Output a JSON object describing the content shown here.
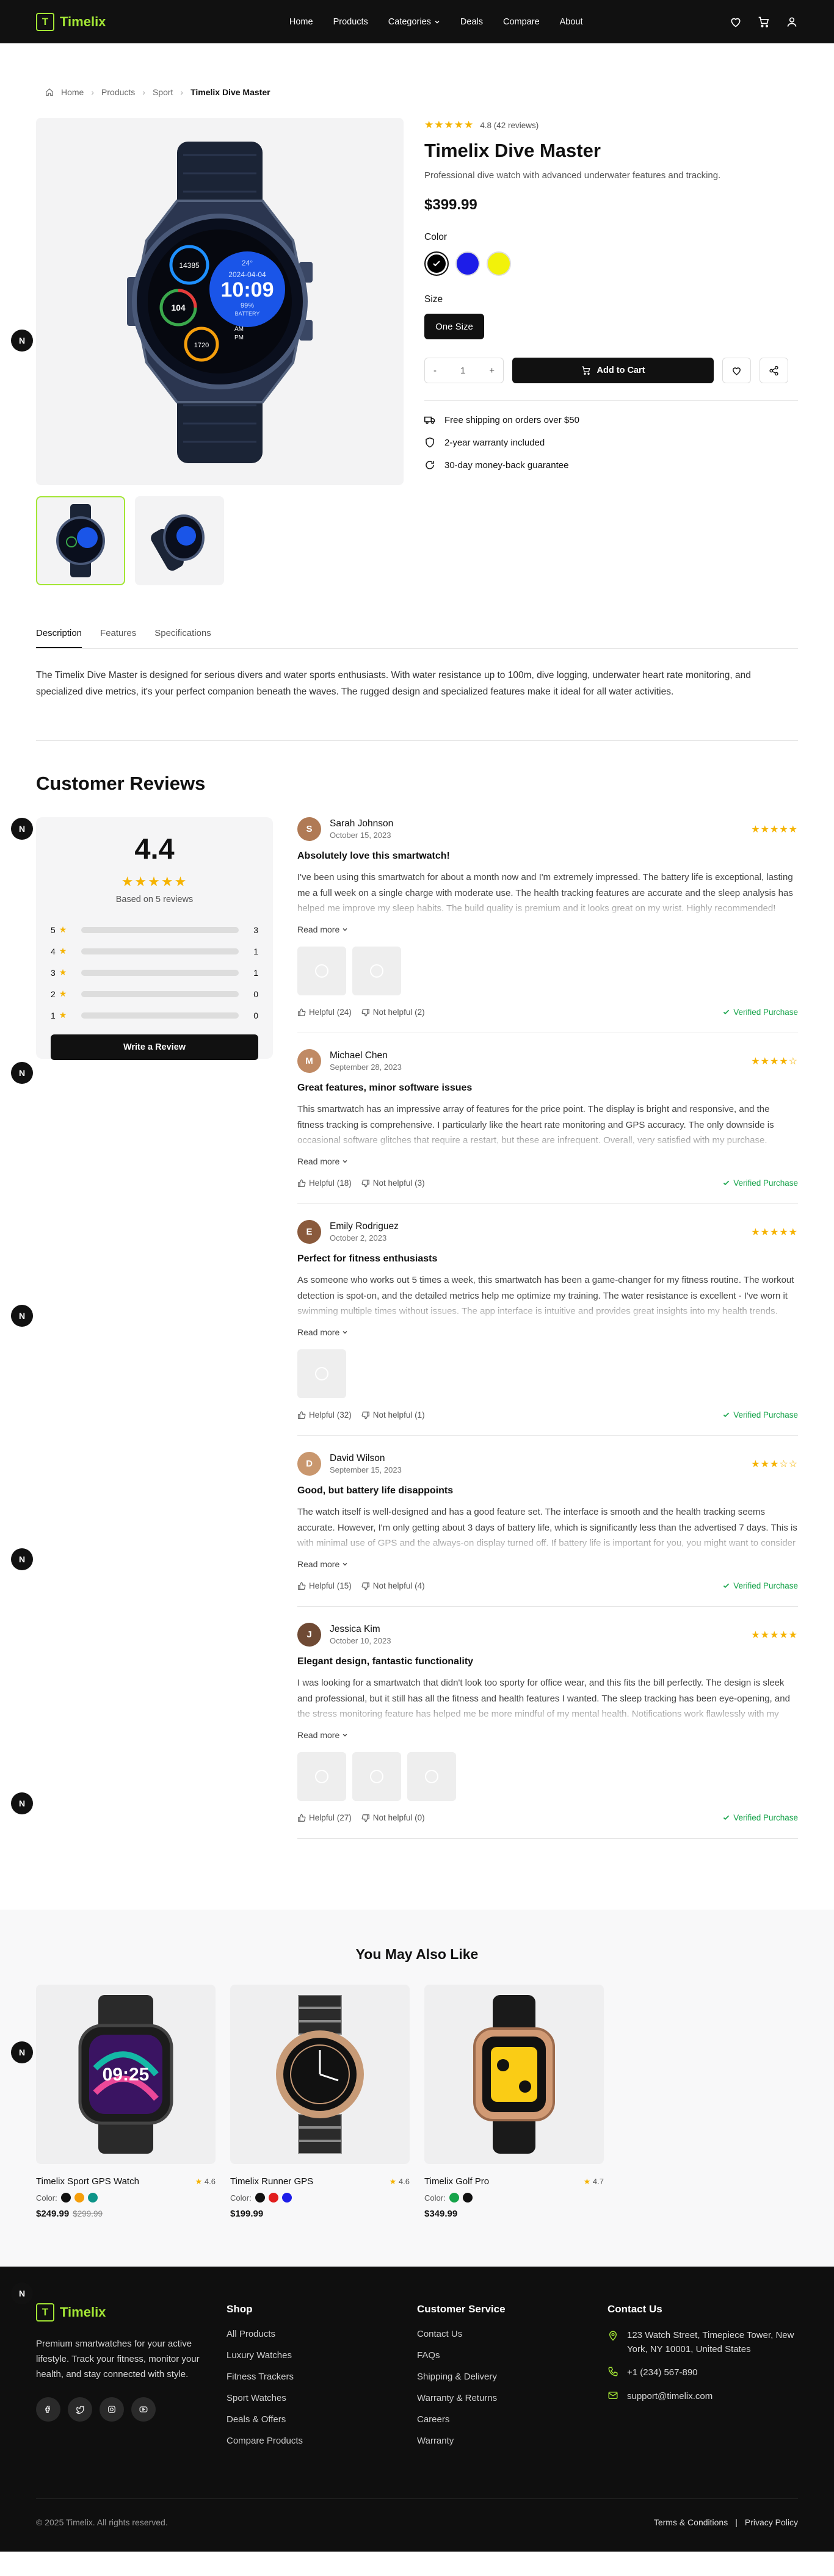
{
  "nav": {
    "brand": "Timelix",
    "brand_letter": "T",
    "menu": [
      "Home",
      "Products",
      "Categories",
      "Deals",
      "Compare",
      "About"
    ]
  },
  "breadcrumb": [
    "Home",
    "Products",
    "Sport",
    "Timelix Dive Master"
  ],
  "product": {
    "rating_text": "4.8 (42 reviews)",
    "rating": 4.8,
    "name": "Timelix Dive Master",
    "description": "Professional dive watch with advanced underwater features and tracking.",
    "price": "$399.99",
    "color_label": "Color",
    "colors": [
      "#000000",
      "#1d1de8",
      "#f2f20a"
    ],
    "size_label": "Size",
    "size": "One Size",
    "qty": "1",
    "qty_minus": "-",
    "qty_plus": "+",
    "add_to_cart": "Add to Cart",
    "perks": [
      "Free shipping on orders over $50",
      "2-year warranty included",
      "30-day money-back guarantee"
    ]
  },
  "watch_face": {
    "time": "10:09",
    "date": "2024-04-04",
    "bpm": "104",
    "steps": "14385",
    "battery": "99%",
    "battery_label": "BATTERY",
    "temp": "24°",
    "am": "AM",
    "pm": "PM",
    "kcal": "1720"
  },
  "tabs": [
    "Description",
    "Features",
    "Specifications"
  ],
  "description_text": "The Timelix Dive Master is designed for serious divers and water sports enthusiasts. With water resistance up to 100m, dive logging, underwater heart rate monitoring, and specialized dive metrics, it's your perfect companion beneath the waves. The rugged design and specialized features make it ideal for all water activities.",
  "reviews_heading": "Customer Reviews",
  "summary": {
    "average": "4.4",
    "based_on": "Based on 5 reviews",
    "breakdown": [
      {
        "star": "5",
        "count": "3"
      },
      {
        "star": "4",
        "count": "1"
      },
      {
        "star": "3",
        "count": "1"
      },
      {
        "star": "2",
        "count": "0"
      },
      {
        "star": "1",
        "count": "0"
      }
    ],
    "write_review": "Write a Review"
  },
  "reviews": [
    {
      "name": "Sarah Johnson",
      "date": "October 15, 2023",
      "stars": 5,
      "title": "Absolutely love this smartwatch!",
      "body": "I've been using this smartwatch for about a month now and I'm extremely impressed. The battery life is exceptional, lasting me a full week on a single charge with moderate use. The health tracking features are accurate and the sleep analysis has helped me improve my sleep habits. The build quality is premium and it looks great on my wrist. Highly recommended!",
      "photos": 2,
      "helpful": "Helpful (24)",
      "not_helpful": "Not helpful (2)"
    },
    {
      "name": "Michael Chen",
      "date": "September 28, 2023",
      "stars": 4,
      "title": "Great features, minor software issues",
      "body": "This smartwatch has an impressive array of features for the price point. The display is bright and responsive, and the fitness tracking is comprehensive. I particularly like the heart rate monitoring and GPS accuracy. The only downside is occasional software glitches that require a restart, but these are infrequent. Overall, very satisfied with my purchase.",
      "photos": 0,
      "helpful": "Helpful (18)",
      "not_helpful": "Not helpful (3)"
    },
    {
      "name": "Emily Rodriguez",
      "date": "October 2, 2023",
      "stars": 5,
      "title": "Perfect for fitness enthusiasts",
      "body": "As someone who works out 5 times a week, this smartwatch has been a game-changer for my fitness routine. The workout detection is spot-on, and the detailed metrics help me optimize my training. The water resistance is excellent - I've worn it swimming multiple times without issues. The app interface is intuitive and provides great insights into my health trends.",
      "photos": 1,
      "helpful": "Helpful (32)",
      "not_helpful": "Not helpful (1)"
    },
    {
      "name": "David Wilson",
      "date": "September 15, 2023",
      "stars": 3,
      "title": "Good, but battery life disappoints",
      "body": "The watch itself is well-designed and has a good feature set. The interface is smooth and the health tracking seems accurate. However, I'm only getting about 3 days of battery life, which is significantly less than the advertised 7 days. This is with minimal use of GPS and the always-on display turned off. If battery life is important for you, you might want to consider other options.",
      "photos": 0,
      "helpful": "Helpful (15)",
      "not_helpful": "Not helpful (4)"
    },
    {
      "name": "Jessica Kim",
      "date": "October 10, 2023",
      "stars": 5,
      "title": "Elegant design, fantastic functionality",
      "body": "I was looking for a smartwatch that didn't look too sporty for office wear, and this fits the bill perfectly. The design is sleek and professional, but it still has all the fitness and health features I wanted. The sleep tracking has been eye-opening, and the stress monitoring feature has helped me be more mindful of my mental health. Notifications work flawlessly with my phone. Couldn't be happier!",
      "photos": 3,
      "helpful": "Helpful (27)",
      "not_helpful": "Not helpful (0)"
    }
  ],
  "review_labels": {
    "read_more": "Read more",
    "verified": "Verified Purchase"
  },
  "related": {
    "heading": "You May Also Like",
    "color_label": "Color:",
    "items": [
      {
        "name": "Timelix Sport GPS Watch",
        "rating": "4.6",
        "colors": [
          "#111111",
          "#f59e0b",
          "#0d9488"
        ],
        "price": "$249.99",
        "old_price": "$299.99",
        "face_time": "09:25"
      },
      {
        "name": "Timelix Runner GPS",
        "rating": "4.6",
        "colors": [
          "#111111",
          "#e11d1d",
          "#1d1de8"
        ],
        "price": "$199.99",
        "old_price": ""
      },
      {
        "name": "Timelix Golf Pro",
        "rating": "4.7",
        "colors": [
          "#16a34a",
          "#111111"
        ],
        "price": "$349.99",
        "old_price": ""
      }
    ]
  },
  "footer": {
    "brand": "Timelix",
    "about": "Premium smartwatches for your active lifestyle. Track your fitness, monitor your health, and stay connected with style.",
    "shop_heading": "Shop",
    "shop_links": [
      "All Products",
      "Luxury Watches",
      "Fitness Trackers",
      "Sport Watches",
      "Deals & Offers",
      "Compare Products"
    ],
    "service_heading": "Customer Service",
    "service_links": [
      "Contact Us",
      "FAQs",
      "Shipping & Delivery",
      "Warranty & Returns",
      "Careers",
      "Warranty"
    ],
    "contact_heading": "Contact Us",
    "address": "123 Watch Street, Timepiece Tower, New York, NY 10001, United States",
    "phone": "+1 (234) 567-890",
    "email": "support@timelix.com",
    "copyright": "© 2025 Timelix. All rights reserved.",
    "terms": "Terms & Conditions",
    "separator": "|",
    "privacy": "Privacy Policy"
  },
  "badge_letter": "N",
  "colors": {
    "accent": "#a3e635",
    "star": "#f5b301",
    "verified": "#16a34a",
    "dark": "#111111"
  }
}
